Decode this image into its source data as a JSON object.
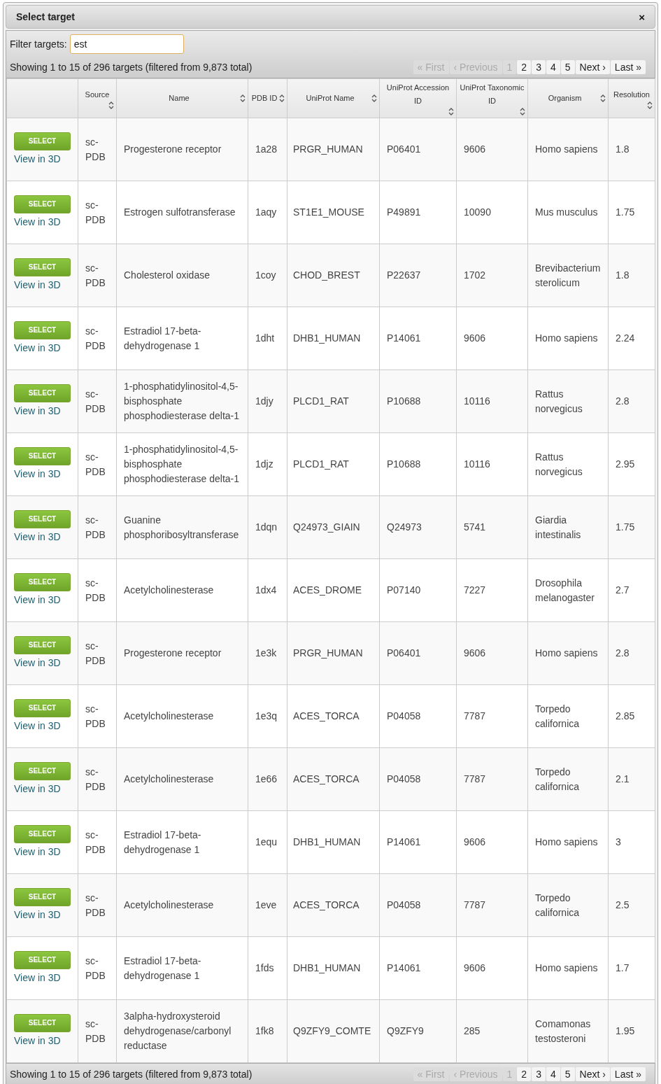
{
  "dialog": {
    "title": "Select target",
    "close": "×"
  },
  "filter": {
    "label": "Filter targets:",
    "value": "est"
  },
  "info_top": "Showing 1 to 15 of 296 targets (filtered from 9,873 total)",
  "pager_top": [
    {
      "label": "« First",
      "disabled": true
    },
    {
      "label": "‹ Previous",
      "disabled": true
    },
    {
      "label": "1",
      "disabled": true
    },
    {
      "label": "2",
      "disabled": false
    },
    {
      "label": "3",
      "disabled": false
    },
    {
      "label": "4",
      "disabled": false
    },
    {
      "label": "5",
      "disabled": false
    },
    {
      "label": "Next ›",
      "disabled": false
    },
    {
      "label": "Last »",
      "disabled": false
    }
  ],
  "table": {
    "columns": [
      {
        "sortable": false
      },
      {
        "label": "Source",
        "sortable": true
      },
      {
        "label": "Name",
        "sortable": true
      },
      {
        "label": "PDB ID",
        "sortable": true
      },
      {
        "label": "UniProt Name",
        "sortable": true
      },
      {
        "label": "UniProt Accession ID",
        "sortable": true
      },
      {
        "label": "UniProt Taxonomic ID",
        "sortable": true
      },
      {
        "label": "Organism",
        "sortable": true
      },
      {
        "label": "Resolution",
        "sortable": true
      }
    ],
    "rows": [
      {
        "button": "SELECT",
        "link": "View in 3D",
        "source": "sc-PDB",
        "name": "Progesterone receptor",
        "pdb": "1a28",
        "uniprot_name": "PRGR_HUMAN",
        "accession": "P06401",
        "taxonomic": "9606",
        "organism": "Homo sapiens",
        "resolution": "1.8"
      },
      {
        "button": "SELECT",
        "link": "View in 3D",
        "source": "sc-PDB",
        "name": "Estrogen sulfotransferase",
        "pdb": "1aqy",
        "uniprot_name": "ST1E1_MOUSE",
        "accession": "P49891",
        "taxonomic": "10090",
        "organism": "Mus musculus",
        "resolution": "1.75"
      },
      {
        "button": "SELECT",
        "link": "View in 3D",
        "source": "sc-PDB",
        "name": "Cholesterol oxidase",
        "pdb": "1coy",
        "uniprot_name": "CHOD_BREST",
        "accession": "P22637",
        "taxonomic": "1702",
        "organism": "Brevibacterium sterolicum",
        "resolution": "1.8"
      },
      {
        "button": "SELECT",
        "link": "View in 3D",
        "source": "sc-PDB",
        "name": "Estradiol 17-beta-dehydrogenase 1",
        "pdb": "1dht",
        "uniprot_name": "DHB1_HUMAN",
        "accession": "P14061",
        "taxonomic": "9606",
        "organism": "Homo sapiens",
        "resolution": "2.24"
      },
      {
        "button": "SELECT",
        "link": "View in 3D",
        "source": "sc-PDB",
        "name": "1-phosphatidylinositol-4,5-bisphosphate phosphodiesterase delta-1",
        "pdb": "1djy",
        "uniprot_name": "PLCD1_RAT",
        "accession": "P10688",
        "taxonomic": "10116",
        "organism": "Rattus norvegicus",
        "resolution": "2.8"
      },
      {
        "button": "SELECT",
        "link": "View in 3D",
        "source": "sc-PDB",
        "name": "1-phosphatidylinositol-4,5-bisphosphate phosphodiesterase delta-1",
        "pdb": "1djz",
        "uniprot_name": "PLCD1_RAT",
        "accession": "P10688",
        "taxonomic": "10116",
        "organism": "Rattus norvegicus",
        "resolution": "2.95"
      },
      {
        "button": "SELECT",
        "link": "View in 3D",
        "source": "sc-PDB",
        "name": "Guanine phosphoribosyltransferase",
        "pdb": "1dqn",
        "uniprot_name": "Q24973_GIAIN",
        "accession": "Q24973",
        "taxonomic": "5741",
        "organism": "Giardia intestinalis",
        "resolution": "1.75"
      },
      {
        "button": "SELECT",
        "link": "View in 3D",
        "source": "sc-PDB",
        "name": "Acetylcholinesterase",
        "pdb": "1dx4",
        "uniprot_name": "ACES_DROME",
        "accession": "P07140",
        "taxonomic": "7227",
        "organism": "Drosophila melanogaster",
        "resolution": "2.7"
      },
      {
        "button": "SELECT",
        "link": "View in 3D",
        "source": "sc-PDB",
        "name": "Progesterone receptor",
        "pdb": "1e3k",
        "uniprot_name": "PRGR_HUMAN",
        "accession": "P06401",
        "taxonomic": "9606",
        "organism": "Homo sapiens",
        "resolution": "2.8"
      },
      {
        "button": "SELECT",
        "link": "View in 3D",
        "source": "sc-PDB",
        "name": "Acetylcholinesterase",
        "pdb": "1e3q",
        "uniprot_name": "ACES_TORCA",
        "accession": "P04058",
        "taxonomic": "7787",
        "organism": "Torpedo californica",
        "resolution": "2.85"
      },
      {
        "button": "SELECT",
        "link": "View in 3D",
        "source": "sc-PDB",
        "name": "Acetylcholinesterase",
        "pdb": "1e66",
        "uniprot_name": "ACES_TORCA",
        "accession": "P04058",
        "taxonomic": "7787",
        "organism": "Torpedo californica",
        "resolution": "2.1"
      },
      {
        "button": "SELECT",
        "link": "View in 3D",
        "source": "sc-PDB",
        "name": "Estradiol 17-beta-dehydrogenase 1",
        "pdb": "1equ",
        "uniprot_name": "DHB1_HUMAN",
        "accession": "P14061",
        "taxonomic": "9606",
        "organism": "Homo sapiens",
        "resolution": "3"
      },
      {
        "button": "SELECT",
        "link": "View in 3D",
        "source": "sc-PDB",
        "name": "Acetylcholinesterase",
        "pdb": "1eve",
        "uniprot_name": "ACES_TORCA",
        "accession": "P04058",
        "taxonomic": "7787",
        "organism": "Torpedo californica",
        "resolution": "2.5"
      },
      {
        "button": "SELECT",
        "link": "View in 3D",
        "source": "sc-PDB",
        "name": "Estradiol 17-beta-dehydrogenase 1",
        "pdb": "1fds",
        "uniprot_name": "DHB1_HUMAN",
        "accession": "P14061",
        "taxonomic": "9606",
        "organism": "Homo sapiens",
        "resolution": "1.7"
      },
      {
        "button": "SELECT",
        "link": "View in 3D",
        "source": "sc-PDB",
        "name": "3alpha-hydroxysteroid dehydrogenase/carbonyl reductase",
        "pdb": "1fk8",
        "uniprot_name": "Q9ZFY9_COMTE",
        "accession": "Q9ZFY9",
        "taxonomic": "285",
        "organism": "Comamonas testosteroni",
        "resolution": "1.95"
      }
    ]
  },
  "info_bottom": "Showing 1 to 15 of 296 targets (filtered from 9,873 total)",
  "pager_bottom": [
    {
      "label": "« First",
      "disabled": true
    },
    {
      "label": "‹ Previous",
      "disabled": true
    },
    {
      "label": "1",
      "disabled": true
    },
    {
      "label": "2",
      "disabled": false
    },
    {
      "label": "3",
      "disabled": false
    },
    {
      "label": "4",
      "disabled": false
    },
    {
      "label": "5",
      "disabled": false
    },
    {
      "label": "Next ›",
      "disabled": false
    },
    {
      "label": "Last »",
      "disabled": false
    }
  ]
}
